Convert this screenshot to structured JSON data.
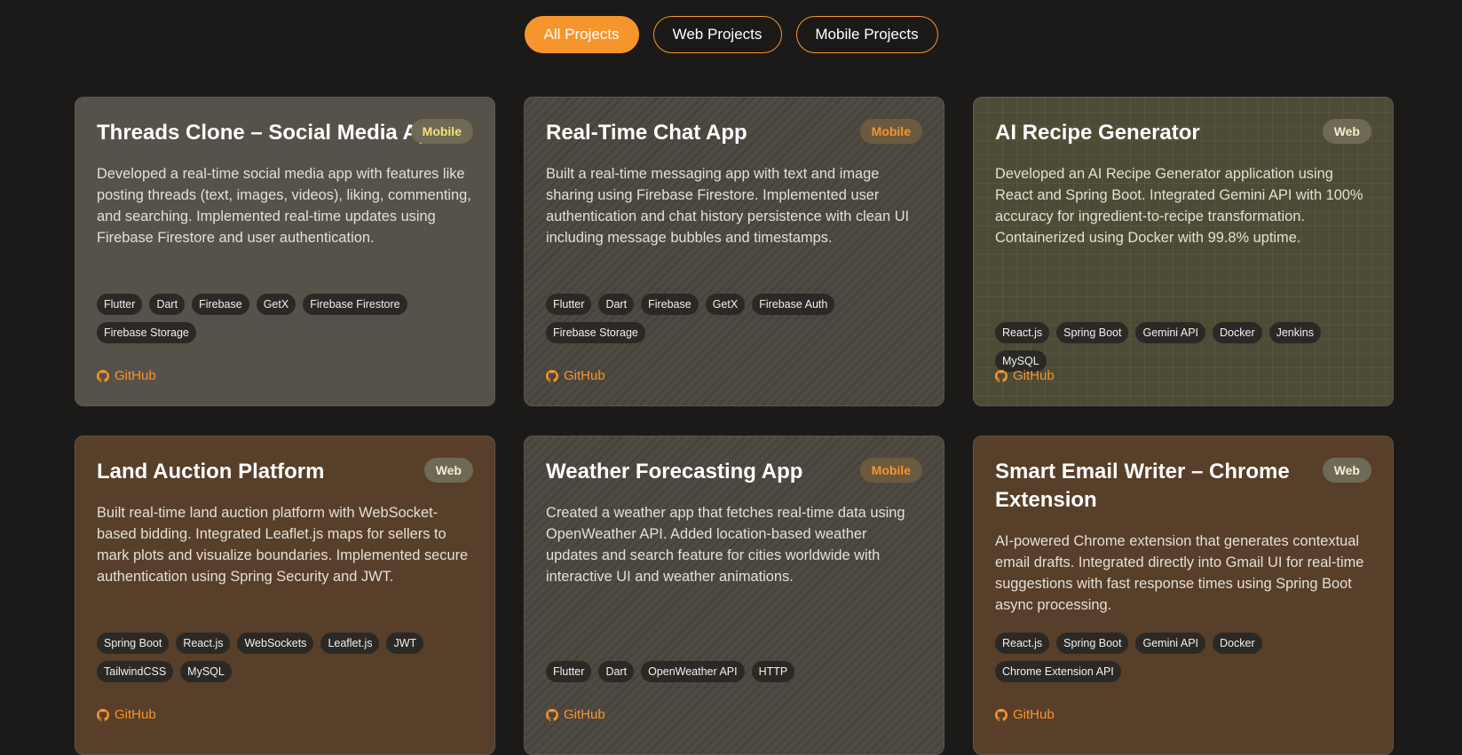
{
  "filters": [
    {
      "label": "All Projects",
      "active": true
    },
    {
      "label": "Web Projects",
      "active": false
    },
    {
      "label": "Mobile Projects",
      "active": false
    }
  ],
  "projects": [
    {
      "title": "Threads Clone – Social Media App",
      "badge": "Mobile",
      "description": "Developed a real-time social media app with features like posting threads (text, images, videos), liking, commenting, and searching. Implemented real-time updates using Firebase Firestore and user authentication.",
      "tags": [
        "Flutter",
        "Dart",
        "Firebase",
        "GetX",
        "Firebase Firestore",
        "Firebase Storage"
      ],
      "link": "GitHub"
    },
    {
      "title": "Real-Time Chat App",
      "badge": "Mobile",
      "description": "Built a real-time messaging app with text and image sharing using Firebase Firestore. Implemented user authentication and chat history persistence with clean UI including message bubbles and timestamps.",
      "tags": [
        "Flutter",
        "Dart",
        "Firebase",
        "GetX",
        "Firebase Auth",
        "Firebase Storage"
      ],
      "link": "GitHub"
    },
    {
      "title": "AI Recipe Generator",
      "badge": "Web",
      "description": "Developed an AI Recipe Generator application using React and Spring Boot. Integrated Gemini API with 100% accuracy for ingredient-to-recipe transformation. Containerized using Docker with 99.8% uptime.",
      "tags": [
        "React.js",
        "Spring Boot",
        "Gemini API",
        "Docker",
        "Jenkins",
        "MySQL"
      ],
      "link": "GitHub"
    },
    {
      "title": "Land Auction Platform",
      "badge": "Web",
      "description": "Built real-time land auction platform with WebSocket-based bidding. Integrated Leaflet.js maps for sellers to mark plots and visualize boundaries. Implemented secure authentication using Spring Security and JWT.",
      "tags": [
        "Spring Boot",
        "React.js",
        "WebSockets",
        "Leaflet.js",
        "JWT",
        "TailwindCSS",
        "MySQL"
      ],
      "link": "GitHub"
    },
    {
      "title": "Weather Forecasting App",
      "badge": "Mobile",
      "description": "Created a weather app that fetches real-time data using OpenWeather API. Added location-based weather updates and search feature for cities worldwide with interactive UI and weather animations.",
      "tags": [
        "Flutter",
        "Dart",
        "OpenWeather API",
        "HTTP"
      ],
      "link": "GitHub"
    },
    {
      "title": "Smart Email Writer – Chrome Extension",
      "badge": "Web",
      "description": "AI-powered Chrome extension that generates contextual email drafts. Integrated directly into Gmail UI for real-time suggestions with fast response times using Spring Boot async processing.",
      "tags": [
        "React.js",
        "Spring Boot",
        "Gemini API",
        "Docker",
        "Chrome Extension API"
      ],
      "link": "GitHub"
    }
  ]
}
